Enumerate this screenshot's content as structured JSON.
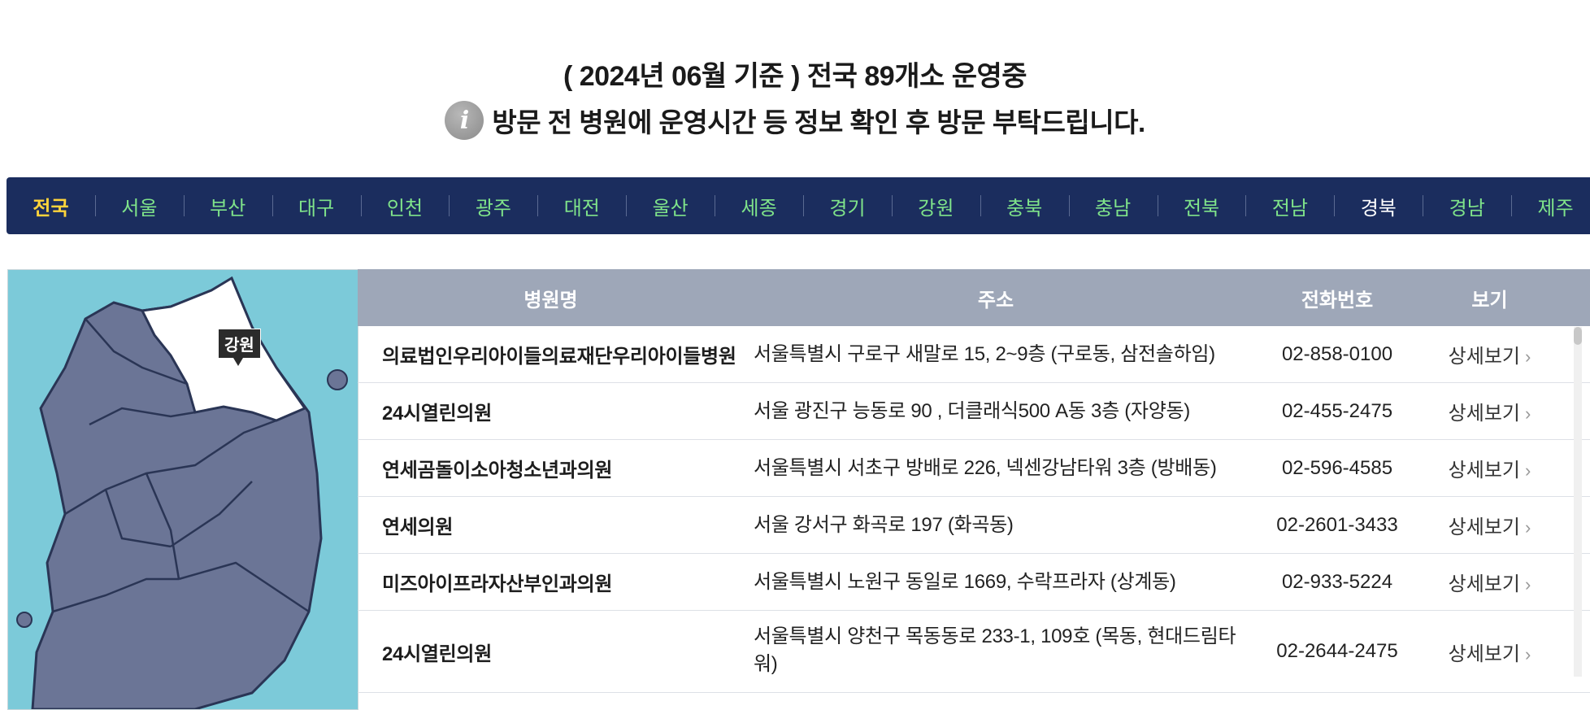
{
  "header": {
    "headline": "( 2024년 06월 기준 ) 전국 89개소 운영중",
    "notice": "방문 전 병원에 운영시간 등 정보 확인 후 방문 부탁드립니다.",
    "info_icon_glyph": "i"
  },
  "regions": [
    {
      "label": "전국",
      "state": "active"
    },
    {
      "label": "서울"
    },
    {
      "label": "부산"
    },
    {
      "label": "대구"
    },
    {
      "label": "인천"
    },
    {
      "label": "광주"
    },
    {
      "label": "대전"
    },
    {
      "label": "울산"
    },
    {
      "label": "세종"
    },
    {
      "label": "경기"
    },
    {
      "label": "강원"
    },
    {
      "label": "충북"
    },
    {
      "label": "충남"
    },
    {
      "label": "전북"
    },
    {
      "label": "전남"
    },
    {
      "label": "경북",
      "state": "plain"
    },
    {
      "label": "경남"
    },
    {
      "label": "제주"
    }
  ],
  "map": {
    "highlight_label": "강원",
    "colors": {
      "sea": "#7ccad9",
      "land": "#6b7596",
      "highlight": "#ffffff",
      "border": "#2a3555"
    }
  },
  "table": {
    "headers": {
      "name": "병원명",
      "address": "주소",
      "phone": "전화번호",
      "view": "보기"
    },
    "detail_label": "상세보기",
    "rows": [
      {
        "name": "의료법인우리아이들의료재단우리아이들병원",
        "address": "서울특별시 구로구 새말로 15, 2~9층 (구로동, 삼전솔하임)",
        "phone": "02-858-0100"
      },
      {
        "name": "24시열린의원",
        "address": "서울 광진구 능동로 90 , 더클래식500 A동 3층 (자양동)",
        "phone": "02-455-2475"
      },
      {
        "name": "연세곰돌이소아청소년과의원",
        "address": "서울특별시 서초구 방배로 226, 넥센강남타워 3층 (방배동)",
        "phone": "02-596-4585"
      },
      {
        "name": "연세의원",
        "address": "서울 강서구 화곡로 197 (화곡동)",
        "phone": "02-2601-3433"
      },
      {
        "name": "미즈아이프라자산부인과의원",
        "address": "서울특별시 노원구 동일로 1669, 수락프라자 (상계동)",
        "phone": "02-933-5224"
      },
      {
        "name": "24시열린의원",
        "address": "서울특별시 양천구 목동동로 233-1, 109호 (목동, 현대드림타워)",
        "phone": "02-2644-2475"
      }
    ]
  },
  "colors": {
    "nav_bg": "#1b2d5e",
    "nav_text": "#7fe38a",
    "nav_active": "#ffd43b",
    "table_header_bg": "#9ea7b8"
  }
}
